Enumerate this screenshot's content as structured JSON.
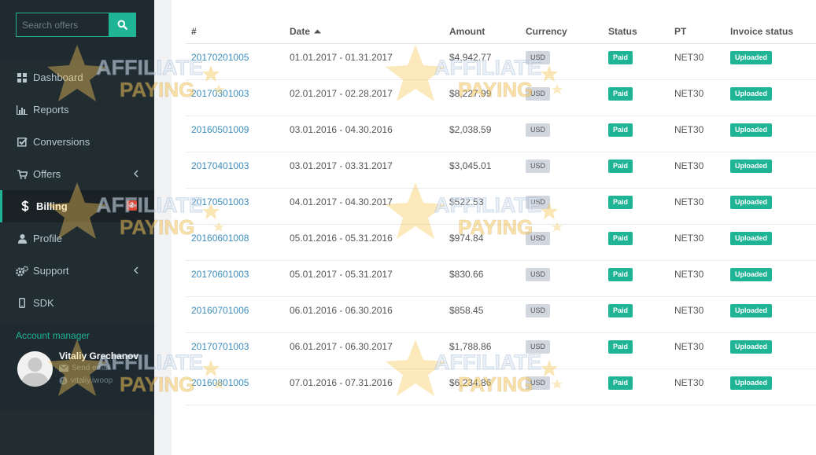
{
  "search": {
    "placeholder": "Search offers"
  },
  "nav": {
    "items": [
      {
        "label": "Dashboard",
        "icon": "dashboard-icon"
      },
      {
        "label": "Reports",
        "icon": "bar-chart-icon"
      },
      {
        "label": "Conversions",
        "icon": "check-square-icon"
      },
      {
        "label": "Offers",
        "icon": "cart-icon",
        "has_caret": true
      },
      {
        "label": "Billing",
        "icon": "dollar-icon",
        "active": true,
        "badge": "2"
      },
      {
        "label": "Profile",
        "icon": "user-icon"
      },
      {
        "label": "Support",
        "icon": "cogs-icon",
        "has_caret": true
      },
      {
        "label": "SDK",
        "icon": "mobile-icon"
      }
    ]
  },
  "account": {
    "title": "Account manager",
    "name": "Vitaliy Grechanov",
    "email_label": "Send email",
    "skype": "vitaliy.iwoop"
  },
  "table": {
    "headers": {
      "id": "#",
      "date": "Date",
      "amount": "Amount",
      "currency": "Currency",
      "status": "Status",
      "pt": "PT",
      "invoice": "Invoice status"
    },
    "rows": [
      {
        "id": "20170201005",
        "date": "01.01.2017 - 01.31.2017",
        "amount": "$4,942.77",
        "currency": "USD",
        "status": "Paid",
        "pt": "NET30",
        "invoice": "Uploaded"
      },
      {
        "id": "20170301003",
        "date": "02.01.2017 - 02.28.2017",
        "amount": "$8,227.99",
        "currency": "USD",
        "status": "Paid",
        "pt": "NET30",
        "invoice": "Uploaded"
      },
      {
        "id": "20160501009",
        "date": "03.01.2016 - 04.30.2016",
        "amount": "$2,038.59",
        "currency": "USD",
        "status": "Paid",
        "pt": "NET30",
        "invoice": "Uploaded"
      },
      {
        "id": "20170401003",
        "date": "03.01.2017 - 03.31.2017",
        "amount": "$3,045.01",
        "currency": "USD",
        "status": "Paid",
        "pt": "NET30",
        "invoice": "Uploaded"
      },
      {
        "id": "20170501003",
        "date": "04.01.2017 - 04.30.2017",
        "amount": "$522.53",
        "currency": "USD",
        "status": "Paid",
        "pt": "NET30",
        "invoice": "Uploaded"
      },
      {
        "id": "20160601008",
        "date": "05.01.2016 - 05.31.2016",
        "amount": "$974.84",
        "currency": "USD",
        "status": "Paid",
        "pt": "NET30",
        "invoice": "Uploaded"
      },
      {
        "id": "20170601003",
        "date": "05.01.2017 - 05.31.2017",
        "amount": "$830.66",
        "currency": "USD",
        "status": "Paid",
        "pt": "NET30",
        "invoice": "Uploaded"
      },
      {
        "id": "20160701006",
        "date": "06.01.2016 - 06.30.2016",
        "amount": "$858.45",
        "currency": "USD",
        "status": "Paid",
        "pt": "NET30",
        "invoice": "Uploaded"
      },
      {
        "id": "20170701003",
        "date": "06.01.2017 - 06.30.2017",
        "amount": "$1,788.86",
        "currency": "USD",
        "status": "Paid",
        "pt": "NET30",
        "invoice": "Uploaded"
      },
      {
        "id": "20160801005",
        "date": "07.01.2016 - 07.31.2016",
        "amount": "$6,234.86",
        "currency": "USD",
        "status": "Paid",
        "pt": "NET30",
        "invoice": "Uploaded"
      }
    ]
  },
  "watermark": {
    "line1": "AFFILIATE",
    "line2": "PAYING"
  },
  "colors": {
    "accent": "#1fb496",
    "sidebar": "#222d32",
    "link": "#3c8dbc",
    "badge_red": "#dd4b39"
  }
}
